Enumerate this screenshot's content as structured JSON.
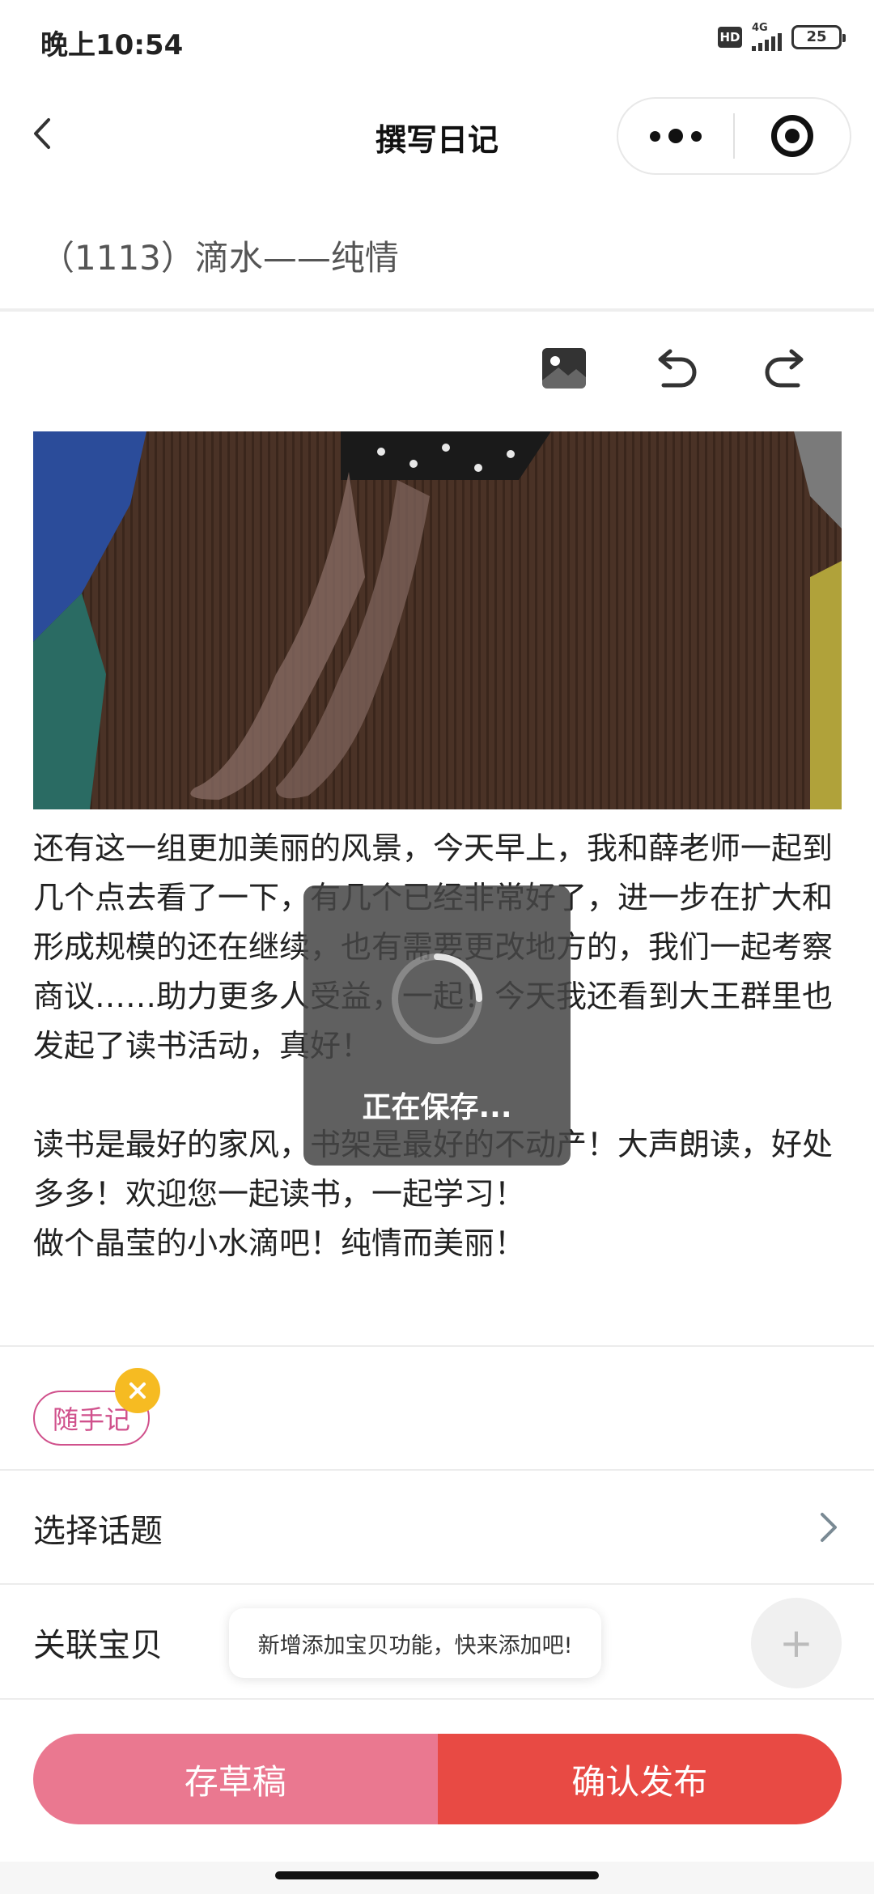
{
  "status_bar": {
    "time": "晚上10:54",
    "hd_badge": "HD",
    "network": "4G",
    "battery": "25"
  },
  "nav": {
    "title": "撰写日记"
  },
  "diary": {
    "title": "（1113）滴水——纯情",
    "paragraphs": [
      "还有这一组更加美丽的风景，今天早上，我和薛老师一起到几个点去看了一下，有几个已经非常好了，进一步在扩大和形成规模的还在继续，也有需要更改地方的，我们一起考察商议……助力更多人受益，一起！今天我还看到大王群里也发起了读书活动，真好！",
      "",
      "读书是最好的家风，书架是最好的不动产！大声朗读，好处多多！欢迎您一起读书，一起学习！",
      "做个晶莹的小水滴吧！纯情而美丽！"
    ]
  },
  "saving_toast": {
    "text": "正在保存..."
  },
  "tag": {
    "label": "随手记"
  },
  "topic_row": {
    "label": "选择话题"
  },
  "baby_row": {
    "label": "关联宝贝",
    "hint": "新增添加宝贝功能，快来添加吧!",
    "add_symbol": "+"
  },
  "actions": {
    "draft_label": "存草稿",
    "publish_label": "确认发布"
  },
  "colors": {
    "accent_pink": "#d0518c",
    "draft_button": "#ea7890",
    "publish_button": "#e84a44",
    "tag_remove": "#f6bb22"
  }
}
